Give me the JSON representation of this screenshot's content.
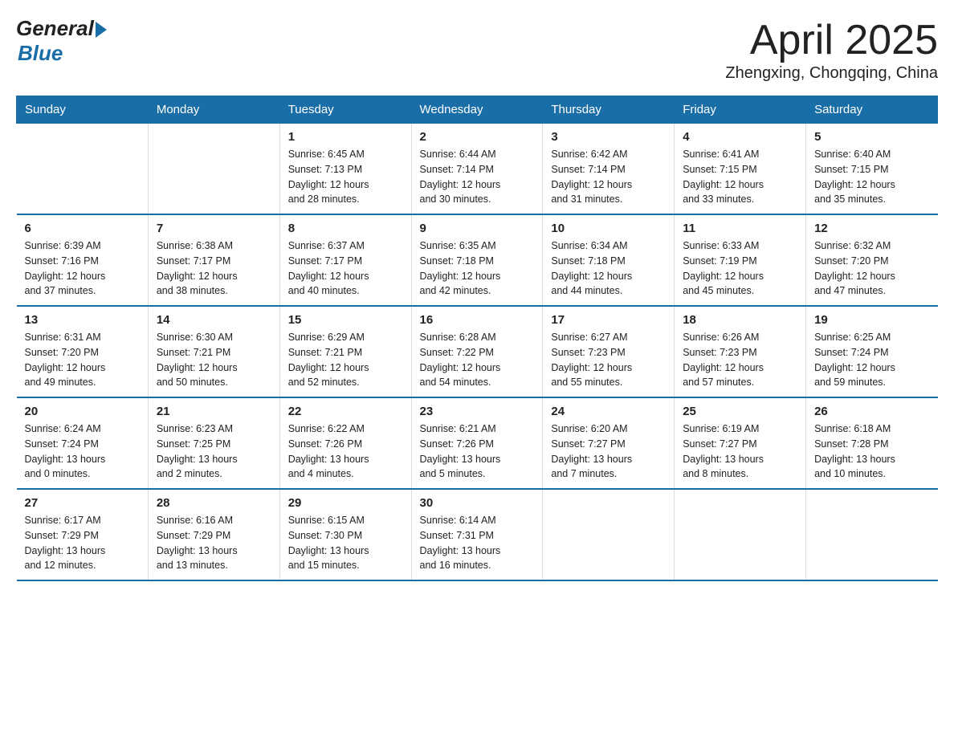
{
  "header": {
    "logo_general": "General",
    "logo_blue": "Blue",
    "title": "April 2025",
    "subtitle": "Zhengxing, Chongqing, China"
  },
  "days_of_week": [
    "Sunday",
    "Monday",
    "Tuesday",
    "Wednesday",
    "Thursday",
    "Friday",
    "Saturday"
  ],
  "weeks": [
    [
      {
        "num": "",
        "info": ""
      },
      {
        "num": "",
        "info": ""
      },
      {
        "num": "1",
        "info": "Sunrise: 6:45 AM\nSunset: 7:13 PM\nDaylight: 12 hours\nand 28 minutes."
      },
      {
        "num": "2",
        "info": "Sunrise: 6:44 AM\nSunset: 7:14 PM\nDaylight: 12 hours\nand 30 minutes."
      },
      {
        "num": "3",
        "info": "Sunrise: 6:42 AM\nSunset: 7:14 PM\nDaylight: 12 hours\nand 31 minutes."
      },
      {
        "num": "4",
        "info": "Sunrise: 6:41 AM\nSunset: 7:15 PM\nDaylight: 12 hours\nand 33 minutes."
      },
      {
        "num": "5",
        "info": "Sunrise: 6:40 AM\nSunset: 7:15 PM\nDaylight: 12 hours\nand 35 minutes."
      }
    ],
    [
      {
        "num": "6",
        "info": "Sunrise: 6:39 AM\nSunset: 7:16 PM\nDaylight: 12 hours\nand 37 minutes."
      },
      {
        "num": "7",
        "info": "Sunrise: 6:38 AM\nSunset: 7:17 PM\nDaylight: 12 hours\nand 38 minutes."
      },
      {
        "num": "8",
        "info": "Sunrise: 6:37 AM\nSunset: 7:17 PM\nDaylight: 12 hours\nand 40 minutes."
      },
      {
        "num": "9",
        "info": "Sunrise: 6:35 AM\nSunset: 7:18 PM\nDaylight: 12 hours\nand 42 minutes."
      },
      {
        "num": "10",
        "info": "Sunrise: 6:34 AM\nSunset: 7:18 PM\nDaylight: 12 hours\nand 44 minutes."
      },
      {
        "num": "11",
        "info": "Sunrise: 6:33 AM\nSunset: 7:19 PM\nDaylight: 12 hours\nand 45 minutes."
      },
      {
        "num": "12",
        "info": "Sunrise: 6:32 AM\nSunset: 7:20 PM\nDaylight: 12 hours\nand 47 minutes."
      }
    ],
    [
      {
        "num": "13",
        "info": "Sunrise: 6:31 AM\nSunset: 7:20 PM\nDaylight: 12 hours\nand 49 minutes."
      },
      {
        "num": "14",
        "info": "Sunrise: 6:30 AM\nSunset: 7:21 PM\nDaylight: 12 hours\nand 50 minutes."
      },
      {
        "num": "15",
        "info": "Sunrise: 6:29 AM\nSunset: 7:21 PM\nDaylight: 12 hours\nand 52 minutes."
      },
      {
        "num": "16",
        "info": "Sunrise: 6:28 AM\nSunset: 7:22 PM\nDaylight: 12 hours\nand 54 minutes."
      },
      {
        "num": "17",
        "info": "Sunrise: 6:27 AM\nSunset: 7:23 PM\nDaylight: 12 hours\nand 55 minutes."
      },
      {
        "num": "18",
        "info": "Sunrise: 6:26 AM\nSunset: 7:23 PM\nDaylight: 12 hours\nand 57 minutes."
      },
      {
        "num": "19",
        "info": "Sunrise: 6:25 AM\nSunset: 7:24 PM\nDaylight: 12 hours\nand 59 minutes."
      }
    ],
    [
      {
        "num": "20",
        "info": "Sunrise: 6:24 AM\nSunset: 7:24 PM\nDaylight: 13 hours\nand 0 minutes."
      },
      {
        "num": "21",
        "info": "Sunrise: 6:23 AM\nSunset: 7:25 PM\nDaylight: 13 hours\nand 2 minutes."
      },
      {
        "num": "22",
        "info": "Sunrise: 6:22 AM\nSunset: 7:26 PM\nDaylight: 13 hours\nand 4 minutes."
      },
      {
        "num": "23",
        "info": "Sunrise: 6:21 AM\nSunset: 7:26 PM\nDaylight: 13 hours\nand 5 minutes."
      },
      {
        "num": "24",
        "info": "Sunrise: 6:20 AM\nSunset: 7:27 PM\nDaylight: 13 hours\nand 7 minutes."
      },
      {
        "num": "25",
        "info": "Sunrise: 6:19 AM\nSunset: 7:27 PM\nDaylight: 13 hours\nand 8 minutes."
      },
      {
        "num": "26",
        "info": "Sunrise: 6:18 AM\nSunset: 7:28 PM\nDaylight: 13 hours\nand 10 minutes."
      }
    ],
    [
      {
        "num": "27",
        "info": "Sunrise: 6:17 AM\nSunset: 7:29 PM\nDaylight: 13 hours\nand 12 minutes."
      },
      {
        "num": "28",
        "info": "Sunrise: 6:16 AM\nSunset: 7:29 PM\nDaylight: 13 hours\nand 13 minutes."
      },
      {
        "num": "29",
        "info": "Sunrise: 6:15 AM\nSunset: 7:30 PM\nDaylight: 13 hours\nand 15 minutes."
      },
      {
        "num": "30",
        "info": "Sunrise: 6:14 AM\nSunset: 7:31 PM\nDaylight: 13 hours\nand 16 minutes."
      },
      {
        "num": "",
        "info": ""
      },
      {
        "num": "",
        "info": ""
      },
      {
        "num": "",
        "info": ""
      }
    ]
  ]
}
